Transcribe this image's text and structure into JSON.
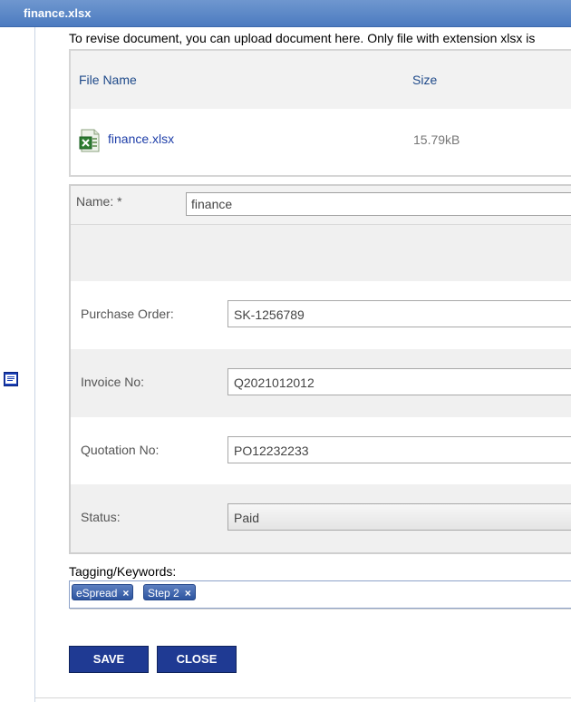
{
  "window": {
    "title": "finance.xlsx"
  },
  "notice": "To revise document, you can upload document here. Only file with extension xlsx is",
  "files_table": {
    "headers": [
      "File Name",
      "Size"
    ],
    "rows": [
      {
        "name": "finance.xlsx",
        "size": "15.79kB"
      }
    ]
  },
  "form": {
    "name_label": "Name: *",
    "name_value": "finance",
    "purchase_order_label": "Purchase Order:",
    "purchase_order_value": "SK-1256789",
    "invoice_label": "Invoice No:",
    "invoice_value": "Q2021012012",
    "quotation_label": "Quotation No:",
    "quotation_value": "PO12232233",
    "status_label": "Status:",
    "status_value": "Paid"
  },
  "tagging": {
    "label": "Tagging/Keywords:",
    "tags": [
      "eSpread",
      "Step 2"
    ],
    "remove_glyph": "×"
  },
  "buttons": {
    "save": "SAVE",
    "close": "CLOSE"
  },
  "colors": {
    "titlebar": "#4c7bc0",
    "button": "#1f3a93",
    "tag": "#2e55a0",
    "link": "#1e3ea8"
  }
}
